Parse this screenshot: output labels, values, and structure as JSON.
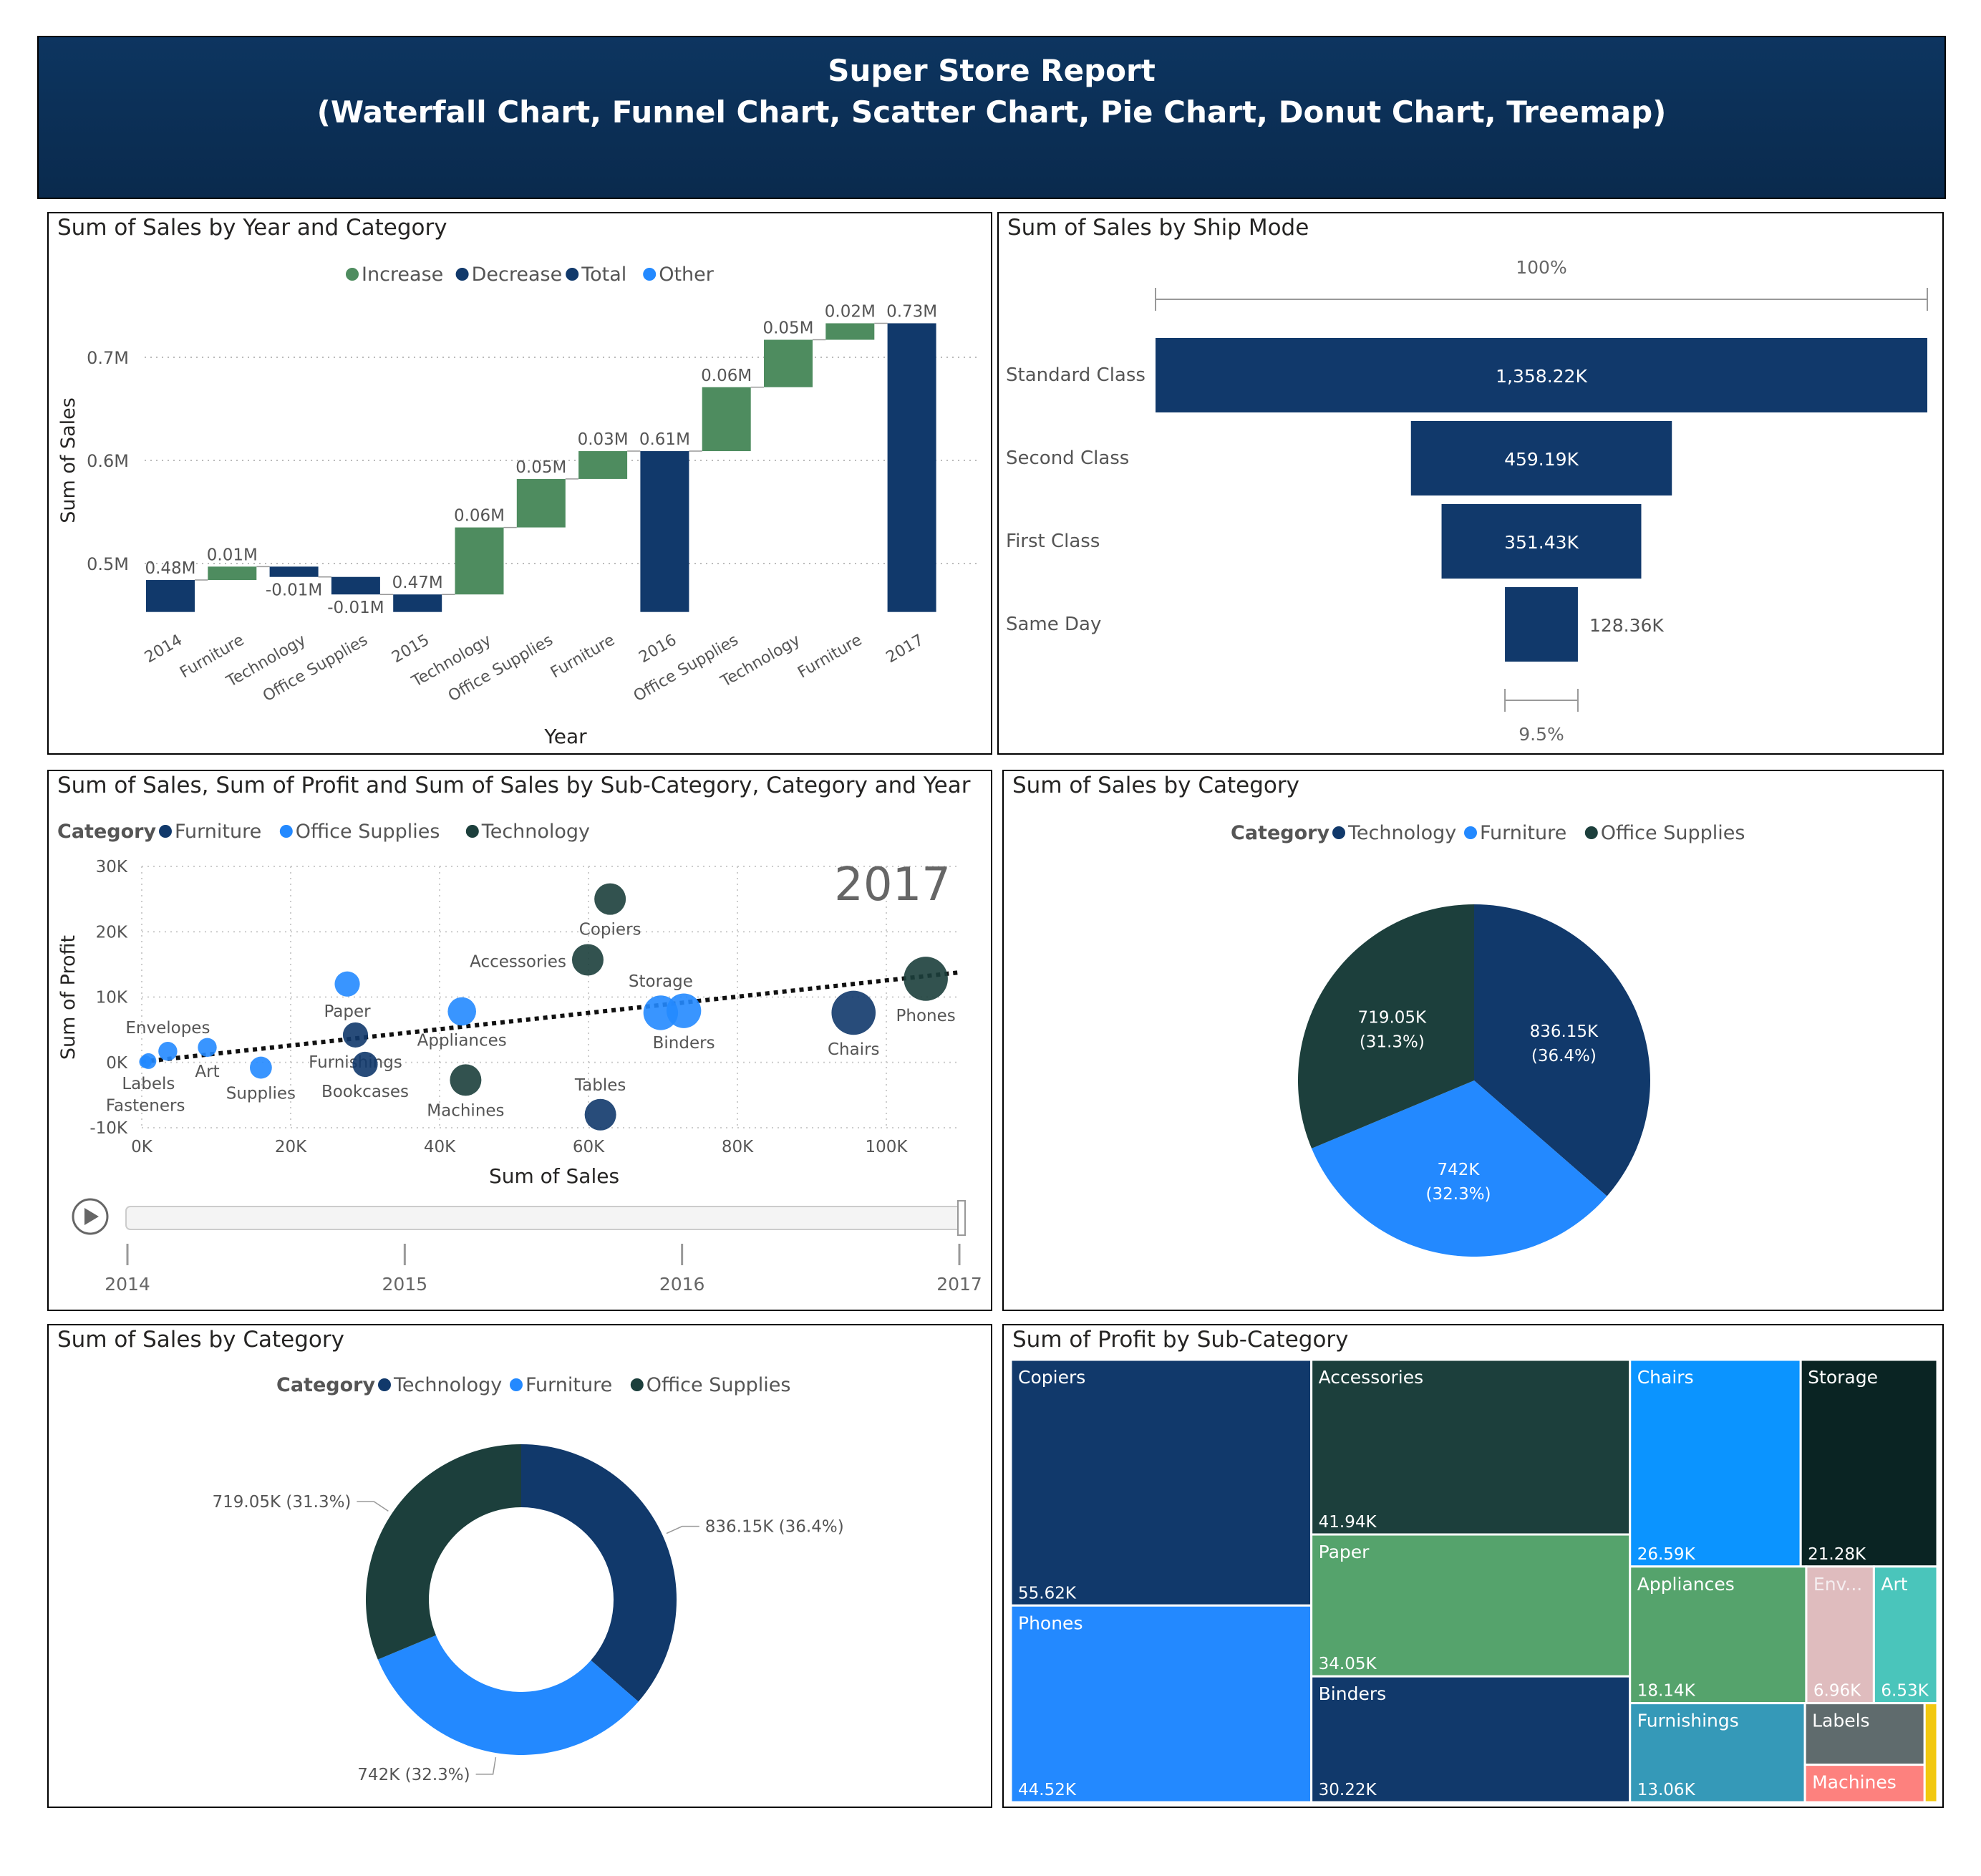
{
  "header": {
    "title": "Super Store Report",
    "subtitle": "(Waterfall Chart, Funnel Chart, Scatter Chart, Pie Chart, Donut Chart, Treemap)"
  },
  "panels": {
    "waterfall_title": "Sum of Sales by Year and Category",
    "funnel_title": "Sum of Sales by Ship Mode",
    "scatter_title": "Sum of Sales, Sum of Profit and Sum of Sales by Sub-Category, Category and Year",
    "pie_title": "Sum of Sales by Category",
    "donut_title": "Sum of Sales by Category",
    "treemap_title": "Sum of Profit by Sub-Category"
  },
  "colors": {
    "navy": "#11396b",
    "green": "#4e8c5f",
    "blue": "#2389ff",
    "dark_teal": "#1c3f3c"
  },
  "chart_data": [
    {
      "type": "bar",
      "subtype": "waterfall",
      "title": "Sum of Sales by Year and Category",
      "xlabel": "Year",
      "ylabel": "Sum of Sales",
      "legend": [
        {
          "name": "Increase",
          "color": "#4e8c5f"
        },
        {
          "name": "Decrease",
          "color": "#11396b"
        },
        {
          "name": "Total",
          "color": "#11396b"
        },
        {
          "name": "Other",
          "color": "#2389ff"
        }
      ],
      "yticks": [
        {
          "value": 0.5,
          "label": "0.5M"
        },
        {
          "value": 0.6,
          "label": "0.6M"
        },
        {
          "value": 0.7,
          "label": "0.7M"
        }
      ],
      "ylim": [
        0.45,
        0.76
      ],
      "grid": true,
      "steps": [
        {
          "category": "2014",
          "kind": "total",
          "start": 0,
          "end": 0.484,
          "label": "0.48M"
        },
        {
          "category": "Furniture",
          "kind": "increase",
          "start": 0.484,
          "end": 0.497,
          "label": "0.01M"
        },
        {
          "category": "Technology",
          "kind": "decrease",
          "start": 0.497,
          "end": 0.487,
          "label": "-0.01M"
        },
        {
          "category": "Office Supplies",
          "kind": "decrease",
          "start": 0.487,
          "end": 0.47,
          "label": "-0.01M"
        },
        {
          "category": "2015",
          "kind": "total",
          "start": 0,
          "end": 0.47,
          "label": "0.47M"
        },
        {
          "category": "Technology",
          "kind": "increase",
          "start": 0.47,
          "end": 0.535,
          "label": "0.06M"
        },
        {
          "category": "Office Supplies",
          "kind": "increase",
          "start": 0.535,
          "end": 0.582,
          "label": "0.05M"
        },
        {
          "category": "Furniture",
          "kind": "increase",
          "start": 0.582,
          "end": 0.609,
          "label": "0.03M"
        },
        {
          "category": "2016",
          "kind": "total",
          "start": 0,
          "end": 0.609,
          "label": "0.61M"
        },
        {
          "category": "Office Supplies",
          "kind": "increase",
          "start": 0.609,
          "end": 0.671,
          "label": "0.06M"
        },
        {
          "category": "Technology",
          "kind": "increase",
          "start": 0.671,
          "end": 0.717,
          "label": "0.05M"
        },
        {
          "category": "Furniture",
          "kind": "increase",
          "start": 0.717,
          "end": 0.733,
          "label": "0.02M"
        },
        {
          "category": "2017",
          "kind": "total",
          "start": 0,
          "end": 0.733,
          "label": "0.73M"
        }
      ]
    },
    {
      "type": "bar",
      "subtype": "funnel",
      "title": "Sum of Sales by Ship Mode",
      "top_label": "100%",
      "bottom_label": "9.5%",
      "categories": [
        "Standard Class",
        "Second Class",
        "First Class",
        "Same Day"
      ],
      "values": [
        1358220,
        459190,
        351430,
        128360
      ],
      "value_labels": [
        "1,358.22K",
        "459.19K",
        "351.43K",
        "128.36K"
      ]
    },
    {
      "type": "scatter",
      "title": "Sum of Sales, Sum of Profit and Sum of Sales by Sub-Category, Category and Year",
      "xlabel": "Sum of Sales",
      "ylabel": "Sum of Profit",
      "year_watermark": "2017",
      "xlim": [
        0,
        110000
      ],
      "ylim": [
        -10000,
        30000
      ],
      "xticks": [
        {
          "value": 0,
          "label": "0K"
        },
        {
          "value": 20000,
          "label": "20K"
        },
        {
          "value": 40000,
          "label": "40K"
        },
        {
          "value": 60000,
          "label": "60K"
        },
        {
          "value": 80000,
          "label": "80K"
        },
        {
          "value": 100000,
          "label": "100K"
        }
      ],
      "yticks": [
        {
          "value": -10000,
          "label": "-10K"
        },
        {
          "value": 0,
          "label": "0K"
        },
        {
          "value": 10000,
          "label": "10K"
        },
        {
          "value": 20000,
          "label": "20K"
        },
        {
          "value": 30000,
          "label": "30K"
        }
      ],
      "legend_title": "Category",
      "legend": [
        {
          "name": "Furniture",
          "color": "#11396b"
        },
        {
          "name": "Office Supplies",
          "color": "#2389ff"
        },
        {
          "name": "Technology",
          "color": "#1c3f3c"
        }
      ],
      "trendline": {
        "x": [
          0,
          110000
        ],
        "y": [
          100,
          13800
        ]
      },
      "play_axis": {
        "labels": [
          "2014",
          "2015",
          "2016",
          "2017"
        ],
        "current": "2017"
      },
      "points": [
        {
          "name": "Copiers",
          "category": "Technology",
          "x": 62900,
          "y": 25000,
          "size": 1.0,
          "label_pos": "below"
        },
        {
          "name": "Accessories",
          "category": "Technology",
          "x": 59900,
          "y": 15700,
          "size": 1.0,
          "label_pos": "left"
        },
        {
          "name": "Phones",
          "category": "Technology",
          "x": 105300,
          "y": 12800,
          "size": 1.4,
          "label_pos": "below"
        },
        {
          "name": "Machines",
          "category": "Technology",
          "x": 43500,
          "y": -2700,
          "size": 1.0,
          "label_pos": "below"
        },
        {
          "name": "Chairs",
          "category": "Furniture",
          "x": 95600,
          "y": 7600,
          "size": 1.4,
          "label_pos": "below"
        },
        {
          "name": "Tables",
          "category": "Furniture",
          "x": 61600,
          "y": -8000,
          "size": 1.0,
          "label_pos": "above"
        },
        {
          "name": "Furnishings",
          "category": "Furniture",
          "x": 28700,
          "y": 4200,
          "size": 0.8,
          "label_pos": "below"
        },
        {
          "name": "Bookcases",
          "category": "Furniture",
          "x": 30000,
          "y": -300,
          "size": 0.8,
          "label_pos": "below"
        },
        {
          "name": "Storage",
          "category": "Office Supplies",
          "x": 69700,
          "y": 7600,
          "size": 1.1,
          "label_pos": "above"
        },
        {
          "name": "Binders",
          "category": "Office Supplies",
          "x": 72800,
          "y": 7900,
          "size": 1.1,
          "label_pos": "below"
        },
        {
          "name": "Appliances",
          "category": "Office Supplies",
          "x": 43000,
          "y": 7800,
          "size": 0.9,
          "label_pos": "below"
        },
        {
          "name": "Paper",
          "category": "Office Supplies",
          "x": 27600,
          "y": 12000,
          "size": 0.8,
          "label_pos": "below"
        },
        {
          "name": "Envelopes",
          "category": "Office Supplies",
          "x": 3500,
          "y": 1700,
          "size": 0.6,
          "label_pos": "above"
        },
        {
          "name": "Art",
          "category": "Office Supplies",
          "x": 8800,
          "y": 2300,
          "size": 0.6,
          "label_pos": "below"
        },
        {
          "name": "Labels",
          "category": "Office Supplies",
          "x": 900,
          "y": 200,
          "size": 0.5,
          "label_pos": "below"
        },
        {
          "name": "Fasteners",
          "category": "Office Supplies",
          "x": 500,
          "y": 100,
          "size": 0.4,
          "label_pos": "below2"
        },
        {
          "name": "Supplies",
          "category": "Office Supplies",
          "x": 16000,
          "y": -800,
          "size": 0.7,
          "label_pos": "below"
        }
      ]
    },
    {
      "type": "pie",
      "title": "Sum of Sales by Category",
      "legend_title": "Category",
      "slices": [
        {
          "name": "Technology",
          "value": 836150,
          "color": "#11396b",
          "label": "836.15K",
          "pct": "(36.4%)"
        },
        {
          "name": "Furniture",
          "value": 742000,
          "color": "#2389ff",
          "label": "742K",
          "pct": "(32.3%)"
        },
        {
          "name": "Office Supplies",
          "value": 719050,
          "color": "#1c3f3c",
          "label": "719.05K",
          "pct": "(31.3%)"
        }
      ]
    },
    {
      "type": "pie",
      "subtype": "donut",
      "title": "Sum of Sales by Category",
      "legend_title": "Category",
      "slices": [
        {
          "name": "Technology",
          "value": 836150,
          "color": "#11396b",
          "label": "836.15K (36.4%)"
        },
        {
          "name": "Furniture",
          "value": 742000,
          "color": "#2389ff",
          "label": "742K (32.3%)"
        },
        {
          "name": "Office Supplies",
          "value": 719050,
          "color": "#1c3f3c",
          "label": "719.05K (31.3%)"
        }
      ]
    },
    {
      "type": "heatmap",
      "subtype": "treemap",
      "title": "Sum of Profit by Sub-Category",
      "items": [
        {
          "name": "Copiers",
          "value": 55620,
          "label": "55.62K",
          "color": "#11396b"
        },
        {
          "name": "Phones",
          "value": 44520,
          "label": "44.52K",
          "color": "#2389ff"
        },
        {
          "name": "Accessories",
          "value": 41940,
          "label": "41.94K",
          "color": "#1c3f3c"
        },
        {
          "name": "Paper",
          "value": 34050,
          "label": "34.05K",
          "color": "#55a36c"
        },
        {
          "name": "Binders",
          "value": 30220,
          "label": "30.22K",
          "color": "#11396b"
        },
        {
          "name": "Chairs",
          "value": 26590,
          "label": "26.59K",
          "color": "#0b94ff"
        },
        {
          "name": "Storage",
          "value": 21280,
          "label": "21.28K",
          "color": "#0a2423"
        },
        {
          "name": "Appliances",
          "value": 18140,
          "label": "18.14K",
          "color": "#55a36c"
        },
        {
          "name": "Env...",
          "value": 6960,
          "label": "6.96K",
          "color": "#dfbcbe"
        },
        {
          "name": "Art",
          "value": 6530,
          "label": "6.53K",
          "color": "#4ac5bb"
        },
        {
          "name": "Furnishings",
          "value": 13060,
          "label": "13.06K",
          "color": "#3599b8"
        },
        {
          "name": "Labels",
          "value": 5550,
          "label": "",
          "color": "#5f6b6d"
        },
        {
          "name": "Machines",
          "value": 3380,
          "label": "",
          "color": "#fd817e"
        },
        {
          "name": "Fasteners",
          "value": 950,
          "label": "",
          "color": "#f2c80f"
        }
      ]
    }
  ]
}
